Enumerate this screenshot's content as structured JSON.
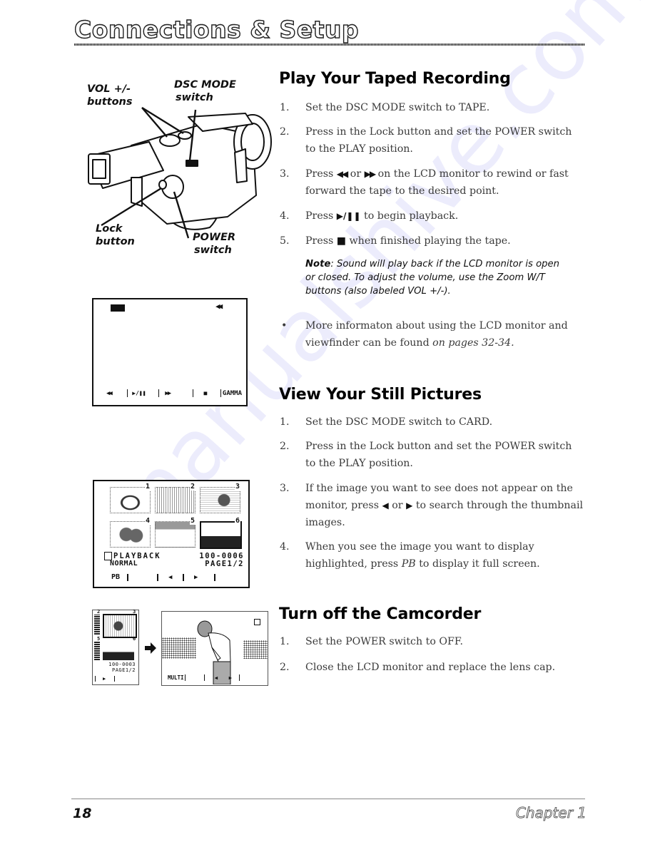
{
  "header": {
    "chapter_title": "Connections & Setup"
  },
  "camera_diagram": {
    "labels": {
      "vol": [
        "VOL +/-",
        "buttons"
      ],
      "dsc_mode": [
        "DSC MODE",
        "switch"
      ],
      "lock": [
        "Lock",
        "button"
      ],
      "power": [
        "POWER",
        "switch"
      ]
    }
  },
  "lcd_tape": {
    "top_right_icon": "◀◀",
    "controls": [
      "◀◀",
      "▶/❚❚",
      "▶▶",
      "■",
      "GAMMA"
    ]
  },
  "lcd_thumbnails": {
    "thumb_numbers": [
      "1",
      "2",
      "3",
      "4",
      "5",
      "6"
    ],
    "selected_thumb": 6,
    "mode_label": "PLAYBACK",
    "sub_label": "NORMAL",
    "file_number": "100-0006",
    "page": "PAGE1/2",
    "controls": [
      "PB",
      "",
      "◀",
      "▶",
      ""
    ]
  },
  "lcd_small": {
    "thumb_numbers": [
      "2",
      "3",
      "5",
      "6"
    ],
    "file_number": "100-0003",
    "page": "PAGE1/2",
    "controls": [
      "▶"
    ]
  },
  "lcd_full": {
    "controls": [
      "MULTI",
      "",
      "◀",
      "▶",
      ""
    ]
  },
  "sections": [
    {
      "heading": "Play Your Taped Recording",
      "steps": [
        {
          "num": "1.",
          "text": "Set the DSC MODE switch to TAPE."
        },
        {
          "num": "2.",
          "text": "Press in the Lock button and set the POWER switch to the PLAY position."
        },
        {
          "num": "3.",
          "pre": "Press ",
          "g1": "◀◀",
          "mid": " or ",
          "g2": "▶▶",
          "post": " on the LCD monitor to rewind or fast forward the tape to the desired point."
        },
        {
          "num": "4.",
          "pre": "Press ",
          "g1": "▶/❚❚",
          "post": " to begin playback."
        },
        {
          "num": "5.",
          "pre": "Press ",
          "g1": "■",
          "post": " when finished playing the tape."
        }
      ],
      "note": {
        "label": "Note",
        "text": ": Sound will play back if the LCD monitor is open or closed. To adjust the volume, use the Zoom W/T buttons (also labeled VOL +/-)."
      },
      "bullet": {
        "mark": "•",
        "text": "More informaton about using the LCD monitor and viewfinder can be found ",
        "ref": "on pages 32-34."
      }
    },
    {
      "heading": "View Your Still Pictures",
      "steps": [
        {
          "num": "1.",
          "text": "Set the DSC MODE switch to CARD."
        },
        {
          "num": "2.",
          "text": "Press in the Lock button and set the POWER switch to the PLAY position."
        },
        {
          "num": "3.",
          "pre": "If the image you want to see does not appear on the monitor, press ",
          "g1": "◀",
          "mid": " or ",
          "g2": "▶",
          "post": " to search through the thumbnail images."
        },
        {
          "num": "4.",
          "pre": "When you see the image you want to display highlighted, press ",
          "ital": "PB",
          "post": " to display it full screen."
        }
      ]
    },
    {
      "heading": "Turn off the Camcorder",
      "steps": [
        {
          "num": "1.",
          "text": "Set the POWER switch to OFF."
        },
        {
          "num": "2.",
          "text": "Close the LCD monitor and replace the lens cap."
        }
      ]
    }
  ],
  "footer": {
    "page_number": "18",
    "chapter": "Chapter 1"
  },
  "watermark": "manualshive.com"
}
